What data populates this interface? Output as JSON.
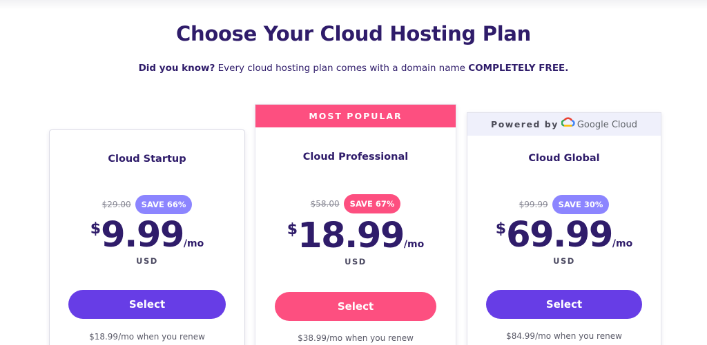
{
  "header": {
    "title": "Choose Your Cloud Hosting Plan",
    "subtitle_lead": "Did you know?",
    "subtitle_body": " Every cloud hosting plan comes with a domain name ",
    "subtitle_emphasis": "COMPLETELY FREE."
  },
  "plans": [
    {
      "name": "Cloud Startup",
      "old_price": "$29.00",
      "save_label": "SAVE 66%",
      "currency_symbol": "$",
      "price": "9.99",
      "period": "/mo",
      "currency": "USD",
      "button_label": "Select",
      "renew_text": "$18.99/mo when you renew"
    },
    {
      "banner": "MOST POPULAR",
      "name": "Cloud Professional",
      "old_price": "$58.00",
      "save_label": "SAVE 67%",
      "currency_symbol": "$",
      "price": "18.99",
      "period": "/mo",
      "currency": "USD",
      "button_label": "Select",
      "renew_text": "$38.99/mo when you renew"
    },
    {
      "banner_prefix": "Powered by",
      "banner_brand": "Google Cloud",
      "name": "Cloud Global",
      "old_price": "$99.99",
      "save_label": "SAVE 30%",
      "currency_symbol": "$",
      "price": "69.99",
      "period": "/mo",
      "currency": "USD",
      "button_label": "Select",
      "renew_text": "$84.99/mo when you renew"
    }
  ],
  "icons": {
    "google_cloud": "google-cloud-icon"
  },
  "colors": {
    "primary_text": "#2f1c6a",
    "accent_purple": "#673de6",
    "accent_pink": "#fd4f80",
    "badge_purple": "#8c85ff"
  }
}
